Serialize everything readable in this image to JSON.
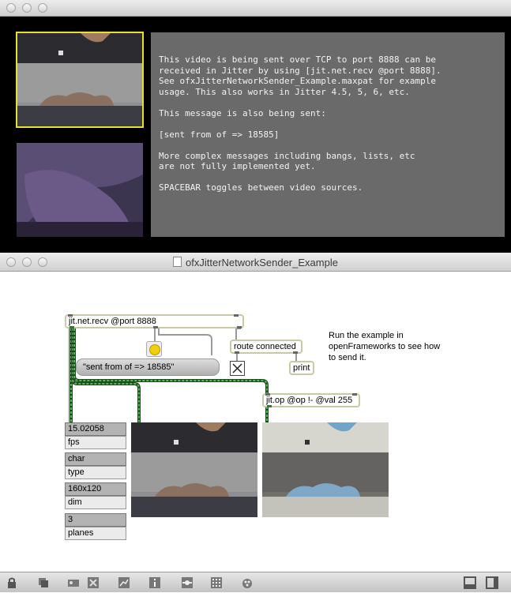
{
  "top_window": {
    "panel_lines": [
      "This video is being sent over TCP to port 8888 can be\nreceived in Jitter by using [jit.net.recv @port 8888].\nSee ofxJitterNetworkSender_Example.maxpat for example\nusage. This also works in Jitter 4.5, 5, 6, etc.",
      "This message is also being sent:",
      "[sent from of => 18585]",
      "More complex messages including bangs, lists, etc\nare not fully implemented yet.",
      "",
      "SPACEBAR toggles between video sources."
    ]
  },
  "patcher": {
    "window_title": "ofxJitterNetworkSender_Example",
    "recv_object": "jit.net.recv @port 8888",
    "route_object": "route connected",
    "print_object": "print",
    "message_box": "\"sent from of => 18585\"",
    "op_object": "jit.op @op !- @val 255",
    "comment": "Run the example in openFrameworks to see how to send it.",
    "readouts": [
      {
        "value": "15.02058",
        "label": "fps"
      },
      {
        "value": "char",
        "label": "type"
      },
      {
        "value": "160x120",
        "label": "dim"
      },
      {
        "value": "3",
        "label": "planes"
      }
    ],
    "colors": {
      "patch_cord_matrix": "#2f7a2f",
      "bang": "#f0cf10",
      "selected_frame": "#e8e030"
    },
    "toolbar_icons": [
      "lock-icon",
      "presentation-icon",
      "patcher-tools-icon",
      "close-square-icon",
      "chart-icon",
      "info-icon",
      "connect-icon",
      "grid-icon",
      "paint-icon",
      "sidebar-icon",
      "split-icon"
    ]
  }
}
